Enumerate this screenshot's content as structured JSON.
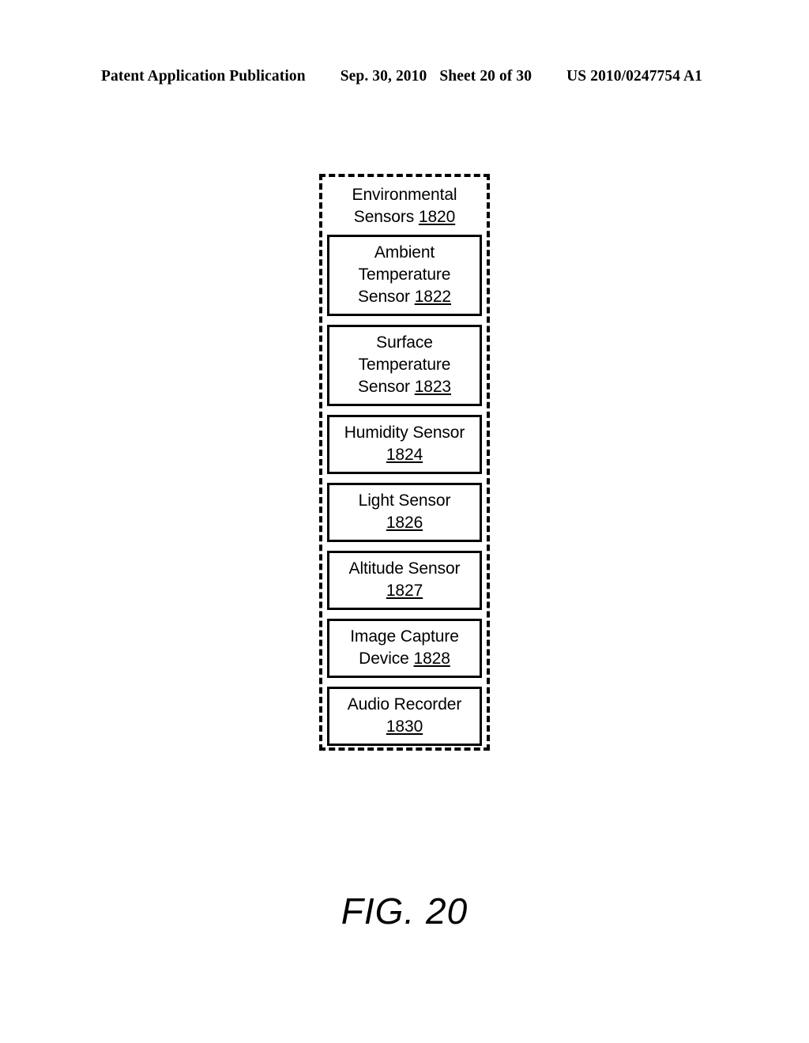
{
  "header": {
    "publication": "Patent Application Publication",
    "date": "Sep. 30, 2010",
    "sheet": "Sheet 20 of 30",
    "patent_number": "US 2010/0247754 A1"
  },
  "figure": {
    "caption": "FIG. 20",
    "group": {
      "title_line1": "Environmental",
      "title_line2": "Sensors",
      "title_ref": "1820",
      "border_style": "dashed"
    },
    "blocks": [
      {
        "name": "ambient-temperature-sensor",
        "lines": [
          "Ambient",
          "Temperature",
          "Sensor"
        ],
        "ref": "1822",
        "ref_inline": true
      },
      {
        "name": "surface-temperature-sensor",
        "lines": [
          "Surface",
          "Temperature",
          "Sensor"
        ],
        "ref": "1823",
        "ref_inline": true
      },
      {
        "name": "humidity-sensor",
        "lines": [
          "Humidity Sensor"
        ],
        "ref": "1824",
        "ref_inline": false
      },
      {
        "name": "light-sensor",
        "lines": [
          "Light Sensor"
        ],
        "ref": "1826",
        "ref_inline": false
      },
      {
        "name": "altitude-sensor",
        "lines": [
          "Altitude Sensor"
        ],
        "ref": "1827",
        "ref_inline": false
      },
      {
        "name": "image-capture-device",
        "lines": [
          "Image Capture",
          "Device"
        ],
        "ref": "1828",
        "ref_inline": true
      },
      {
        "name": "audio-recorder",
        "lines": [
          "Audio Recorder"
        ],
        "ref": "1830",
        "ref_inline": false
      }
    ]
  }
}
